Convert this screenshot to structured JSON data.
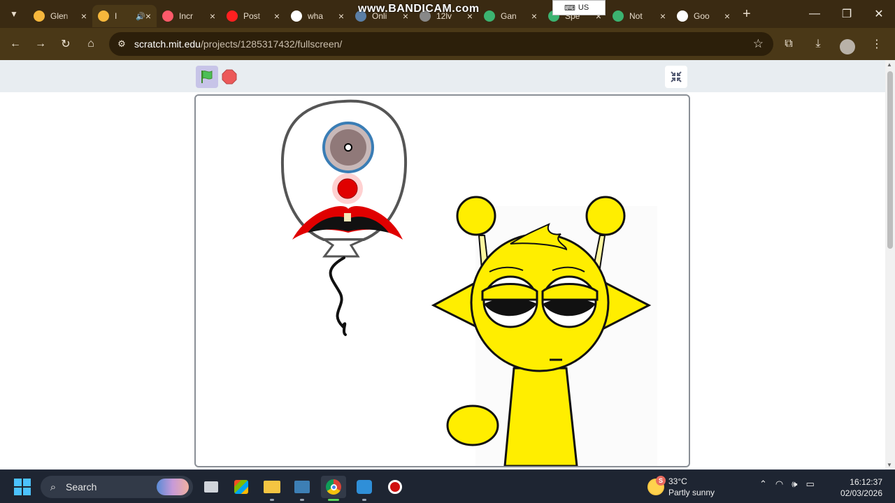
{
  "browser": {
    "tabs": [
      {
        "title": "Glen",
        "icon": "scratch-icon",
        "color": "#f6b73c",
        "active": false
      },
      {
        "title": "I",
        "icon": "scratch-icon",
        "color": "#f6b73c",
        "active": true,
        "audio": true
      },
      {
        "title": "Incr",
        "icon": "t-icon",
        "color": "#ff5a6a",
        "active": false
      },
      {
        "title": "Post",
        "icon": "youtube-icon",
        "color": "#ff2020",
        "active": false
      },
      {
        "title": "wha",
        "icon": "google-icon",
        "color": "#ffffff",
        "active": false
      },
      {
        "title": "Onli",
        "icon": "grid-icon",
        "color": "#5b7fa6",
        "active": false
      },
      {
        "title": "12lv",
        "icon": "app-icon",
        "color": "#888888",
        "active": false
      },
      {
        "title": "Gan",
        "icon": "app-icon",
        "color": "#3cb371",
        "active": false
      },
      {
        "title": "Spe",
        "icon": "app-icon",
        "color": "#3cb371",
        "active": false
      },
      {
        "title": "Not",
        "icon": "notion-icon",
        "color": "#3cb371",
        "active": false
      },
      {
        "title": "Goo",
        "icon": "google-icon",
        "color": "#ffffff",
        "active": false
      }
    ],
    "url_host": "scratch.mit.edu",
    "url_path": "/projects/1285317432/fullscreen/"
  },
  "overlay": {
    "watermark": "www.BANDICAM.com",
    "keyboard_layout": "US"
  },
  "scratch": {
    "green_flag": "green-flag-icon",
    "stop": "stop-icon",
    "exit_fullscreen": "exit-fullscreen-icon"
  },
  "taskbar": {
    "search_label": "Search",
    "weather_temp": "33°C",
    "weather_desc": "Partly sunny",
    "weather_badge": "S",
    "time": "16:12:37",
    "date": "02/03/2026"
  },
  "colors": {
    "browser_frame": "#3a2a12",
    "toolbar": "#4a3817",
    "scratch_bar": "#e8edf1",
    "character_yellow": "#ffee00",
    "balloon_red": "#e00000"
  }
}
